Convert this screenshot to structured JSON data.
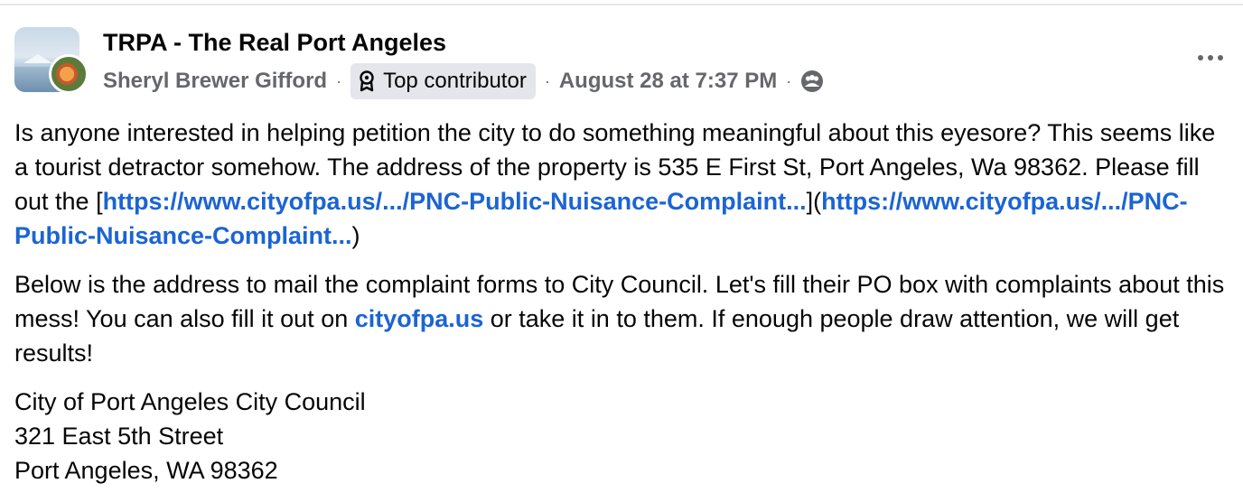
{
  "group": {
    "name": "TRPA - The Real Port Angeles"
  },
  "post": {
    "author": "Sheryl Brewer Gifford",
    "badge_label": "Top contributor",
    "badge_icon": "contributor-badge-icon",
    "date": "August 28 at 7:37 PM",
    "audience_icon": "group-members-icon",
    "more_icon": "more-options-icon"
  },
  "body": {
    "p1_text_1": "Is anyone interested in helping petition the city to do something meaningful about this eyesore? This seems like a tourist detractor somehow. The address of the property is 535 E First St, Port Angeles, Wa 98362. Please fill out the [",
    "p1_link_1": "https://www.cityofpa.us/.../PNC-Public-Nuisance-Complaint...",
    "p1_text_2": "](",
    "p1_link_2": "https://www.cityofpa.us/.../PNC-Public-Nuisance-Complaint...",
    "p1_text_3": ")",
    "p2_text_1": "Below is the address to mail the complaint forms to City Council. Let's fill their PO box with complaints about this mess! You can also fill it out on ",
    "p2_link": "cityofpa.us",
    "p2_text_2": " or take it in to them. If enough people draw attention, we will get results!",
    "address_line_1": "City of Port Angeles City Council",
    "address_line_2": "321 East 5th Street",
    "address_line_3": "Port Angeles, WA 98362"
  }
}
